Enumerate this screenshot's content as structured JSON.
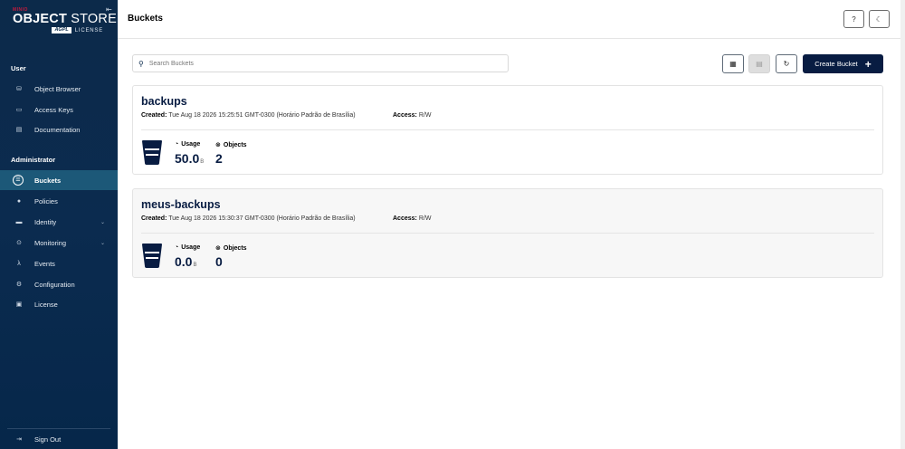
{
  "logo": {
    "brand": "MINIO",
    "title_bold": "OBJECT",
    "title_thin": "STORE",
    "agpl": "AGPL",
    "license_text": "LICENSE"
  },
  "sidebar": {
    "user_section": "User",
    "user_items": [
      {
        "label": "Object Browser",
        "icon": "object-browser-icon"
      },
      {
        "label": "Access Keys",
        "icon": "access-keys-icon"
      },
      {
        "label": "Documentation",
        "icon": "documentation-icon"
      }
    ],
    "admin_section": "Administrator",
    "admin_items": [
      {
        "label": "Buckets",
        "icon": "buckets-icon",
        "active": true
      },
      {
        "label": "Policies",
        "icon": "policies-icon"
      },
      {
        "label": "Identity",
        "icon": "identity-icon",
        "expandable": true
      },
      {
        "label": "Monitoring",
        "icon": "monitoring-icon",
        "expandable": true
      },
      {
        "label": "Events",
        "icon": "lambda-icon"
      },
      {
        "label": "Configuration",
        "icon": "gear-icon"
      },
      {
        "label": "License",
        "icon": "license-icon"
      }
    ],
    "sign_out": "Sign Out"
  },
  "header": {
    "title": "Buckets"
  },
  "toolbar": {
    "search_placeholder": "Search Buckets",
    "create_label": "Create Bucket"
  },
  "buckets": [
    {
      "name": "backups",
      "created_label": "Created:",
      "created": "Tue Aug 18 2026 15:25:51 GMT-0300 (Horário Padrão de Brasília)",
      "access_label": "Access:",
      "access": "R/W",
      "usage_label": "Usage",
      "usage_value": "50.0",
      "usage_unit": "B",
      "objects_label": "Objects",
      "objects_value": "2"
    },
    {
      "name": "meus-backups",
      "created_label": "Created:",
      "created": "Tue Aug 18 2026 15:30:37 GMT-0300 (Horário Padrão de Brasília)",
      "access_label": "Access:",
      "access": "R/W",
      "usage_label": "Usage",
      "usage_value": "0.0",
      "usage_unit": "B",
      "objects_label": "Objects",
      "objects_value": "0"
    }
  ],
  "colors": {
    "sidebar_bg": "#0c2a4a",
    "active_item": "#1c5878",
    "brand_red": "#c51b3d",
    "primary": "#081c42"
  }
}
